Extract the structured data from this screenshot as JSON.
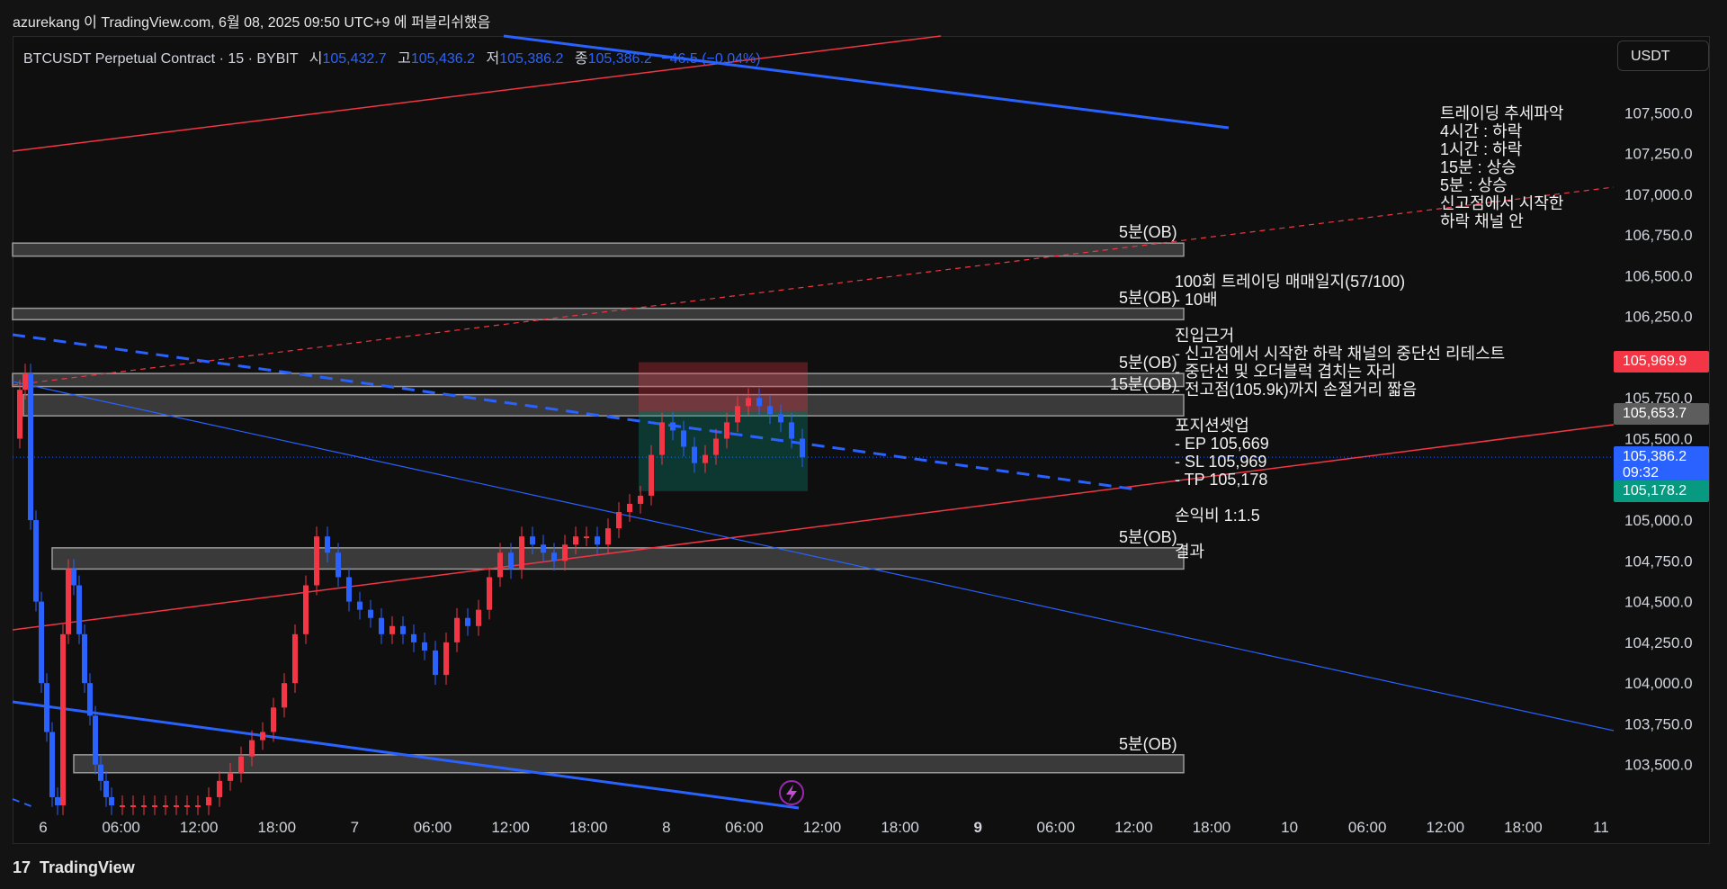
{
  "topbar": {
    "caption": "azurekang 이 TradingView.com, 6월 08, 2025 09:50 UTC+9 에 퍼블리쉬했음"
  },
  "legend": {
    "symbol": "BTCUSDT Perpetual Contract · 15 · BYBIT",
    "open_label": "시",
    "open": "105,432.7",
    "high_label": "고",
    "high": "105,436.2",
    "low_label": "저",
    "low": "105,386.2",
    "close_label": "종",
    "close": "105,386.2",
    "change": "−46.5 (−0.04%)"
  },
  "currency_button": "USDT",
  "chart_data": {
    "type": "candlestick",
    "symbol": "BTCUSDT",
    "timeframe": "15",
    "exchange": "BYBIT",
    "ylim": [
      103250,
      107750
    ],
    "y_ticks": [
      "107,500.0",
      "107,250.0",
      "107,000.0",
      "106,750.0",
      "106,500.0",
      "106,250.0",
      "106,000.0",
      "105,750.0",
      "105,500.0",
      "105,250.0",
      "105,000.0",
      "104,750.0",
      "104,500.0",
      "104,250.0",
      "104,000.0",
      "103,750.0",
      "103,500.0"
    ],
    "x_ticks": [
      {
        "label": "6",
        "bold": false
      },
      {
        "label": "06:00",
        "bold": false
      },
      {
        "label": "12:00",
        "bold": false
      },
      {
        "label": "18:00",
        "bold": false
      },
      {
        "label": "7",
        "bold": false
      },
      {
        "label": "06:00",
        "bold": false
      },
      {
        "label": "12:00",
        "bold": false
      },
      {
        "label": "18:00",
        "bold": false
      },
      {
        "label": "8",
        "bold": false
      },
      {
        "label": "06:00",
        "bold": false
      },
      {
        "label": "12:00",
        "bold": false
      },
      {
        "label": "18:00",
        "bold": false
      },
      {
        "label": "9",
        "bold": true
      },
      {
        "label": "06:00",
        "bold": false
      },
      {
        "label": "12:00",
        "bold": false
      },
      {
        "label": "18:00",
        "bold": false
      },
      {
        "label": "10",
        "bold": false
      },
      {
        "label": "06:00",
        "bold": false
      },
      {
        "label": "12:00",
        "bold": false
      },
      {
        "label": "18:00",
        "bold": false
      },
      {
        "label": "11",
        "bold": false
      }
    ],
    "price_path": [
      [
        0,
        105500
      ],
      [
        0.5,
        105800
      ],
      [
        1,
        105900
      ],
      [
        1.5,
        105000
      ],
      [
        2,
        104500
      ],
      [
        2.5,
        104000
      ],
      [
        3,
        103700
      ],
      [
        3.5,
        103300
      ],
      [
        4,
        103250
      ],
      [
        4.5,
        104300
      ],
      [
        5,
        104700
      ],
      [
        5.5,
        104600
      ],
      [
        6,
        104300
      ],
      [
        6.5,
        104000
      ],
      [
        7,
        103800
      ],
      [
        7.5,
        103500
      ],
      [
        8,
        103400
      ],
      [
        8.5,
        103300
      ],
      [
        9,
        103250
      ],
      [
        10,
        103250
      ],
      [
        11,
        103250
      ],
      [
        12,
        103250
      ],
      [
        13,
        103250
      ],
      [
        14,
        103250
      ],
      [
        15,
        103250
      ],
      [
        16,
        103250
      ],
      [
        17,
        103250
      ],
      [
        18,
        103300
      ],
      [
        19,
        103400
      ],
      [
        20,
        103450
      ],
      [
        21,
        103550
      ],
      [
        22,
        103650
      ],
      [
        23,
        103700
      ],
      [
        24,
        103850
      ],
      [
        25,
        104000
      ],
      [
        26,
        104300
      ],
      [
        27,
        104600
      ],
      [
        28,
        104900
      ],
      [
        29,
        104800
      ],
      [
        30,
        104650
      ],
      [
        31,
        104500
      ],
      [
        32,
        104450
      ],
      [
        33,
        104400
      ],
      [
        34,
        104300
      ],
      [
        35,
        104350
      ],
      [
        36,
        104300
      ],
      [
        37,
        104250
      ],
      [
        38,
        104200
      ],
      [
        39,
        104050
      ],
      [
        40,
        104250
      ],
      [
        41,
        104400
      ],
      [
        42,
        104350
      ],
      [
        43,
        104450
      ],
      [
        44,
        104650
      ],
      [
        45,
        104800
      ],
      [
        46,
        104700
      ],
      [
        47,
        104900
      ],
      [
        48,
        104850
      ],
      [
        49,
        104800
      ],
      [
        50,
        104750
      ],
      [
        51,
        104850
      ],
      [
        52,
        104900
      ],
      [
        53,
        104900
      ],
      [
        54,
        104850
      ],
      [
        55,
        104950
      ],
      [
        56,
        105050
      ],
      [
        57,
        105100
      ],
      [
        58,
        105150
      ],
      [
        59,
        105400
      ],
      [
        60,
        105600
      ],
      [
        61,
        105550
      ],
      [
        62,
        105450
      ],
      [
        63,
        105350
      ],
      [
        64,
        105400
      ],
      [
        65,
        105500
      ],
      [
        66,
        105600
      ],
      [
        67,
        105700
      ],
      [
        68,
        105750
      ],
      [
        69,
        105700
      ],
      [
        70,
        105650
      ],
      [
        71,
        105600
      ],
      [
        72,
        105500
      ],
      [
        73,
        105386
      ]
    ],
    "zones": [
      {
        "label": "5분(OB)",
        "top": 106700,
        "bottom": 106620
      },
      {
        "label": "5분(OB)",
        "top": 106300,
        "bottom": 106230
      },
      {
        "label": "5분(OB)",
        "top": 105900,
        "bottom": 105820
      },
      {
        "label": "15분(OB)",
        "top": 105770,
        "bottom": 105640
      },
      {
        "label": "5분(OB)",
        "top": 104830,
        "bottom": 104700
      },
      {
        "label": "5분(OB)",
        "top": 103560,
        "bottom": 103450
      }
    ],
    "position": {
      "side": "short",
      "entry": 105669,
      "stop": 105969,
      "target": 105178
    },
    "price_tags": [
      {
        "price": "105,969.9",
        "color": "#f23645"
      },
      {
        "price": "105,653.7",
        "color": "#5d5d5d"
      },
      {
        "price": "105,386.2",
        "time": "09:32",
        "color": "#2962ff"
      },
      {
        "price": "105,178.2",
        "color": "#089981"
      }
    ],
    "colors": {
      "up": "#f23645",
      "down": "#2962ff",
      "red_line": "#f23645",
      "blue_line": "#2962ff"
    }
  },
  "annotations": {
    "trend": [
      "트레이딩 추세파악",
      "4시간 : 하락",
      "1시간 : 하락",
      "15분 : 상승",
      "5분 : 상승",
      "신고점에서 시작한",
      "하락 채널 안"
    ],
    "journal": [
      "100회 트레이딩 매매일지(57/100)",
      "- 10배",
      "",
      "진입근거",
      "- 신고점에서 시작한 하락 채널의 중단선 리테스트",
      "- 중단선 및 오더블럭 겹치는 자리",
      "- 전고점(105.9k)까지 손절거리 짧음",
      "",
      "포지션셋업",
      "- EP 105,669",
      "- SL 105,969",
      "- TP 105,178",
      "",
      "손익비 1:1.5",
      "",
      "결과"
    ]
  },
  "footer": {
    "brand": "TradingView",
    "logo_icon": "tradingview-logo-icon",
    "alert_icon": "lightning-icon"
  }
}
